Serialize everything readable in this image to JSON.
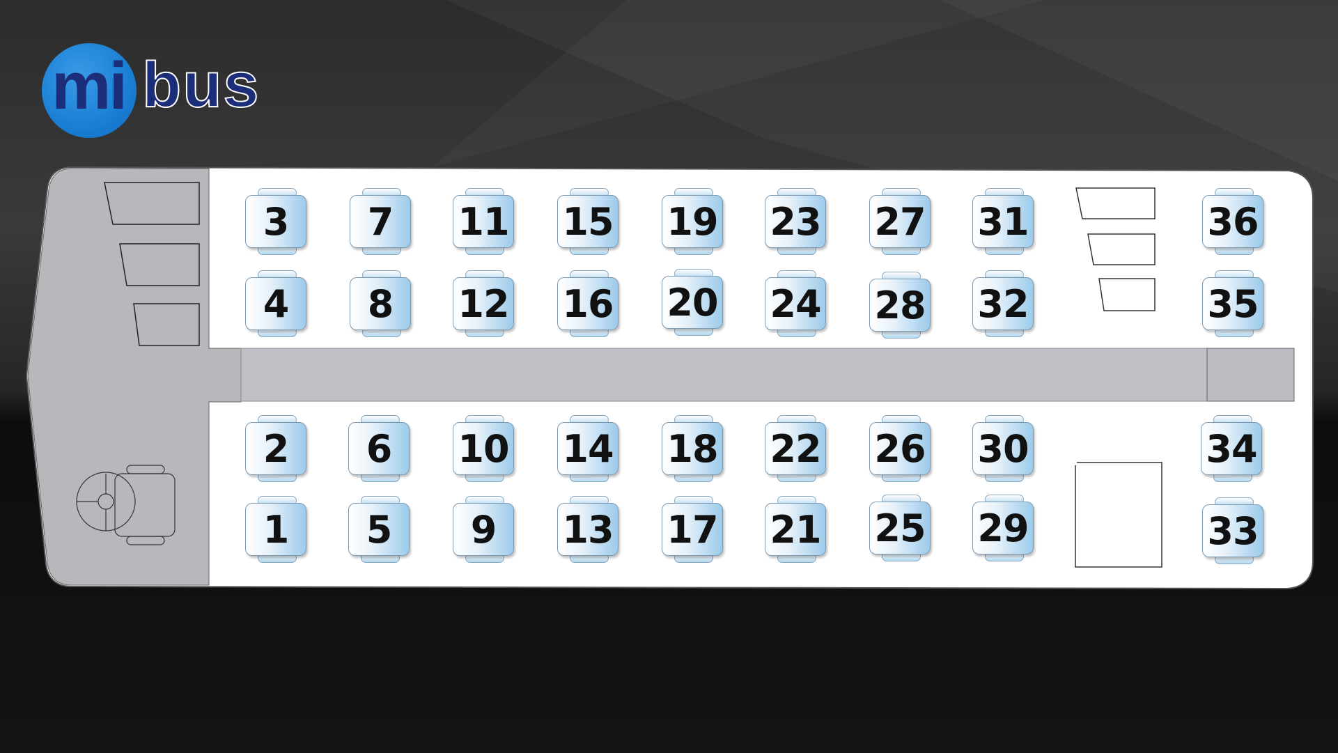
{
  "brand": {
    "prefix": "mi",
    "suffix": "bus",
    "color": "#1c2d7a",
    "circle_color": "#1a7fd4"
  },
  "colors": {
    "seat_accent": "#9ccbea",
    "aisle": "#bfbfc6",
    "driver_area": "#b8b8bc"
  },
  "seats": {
    "top_window": [
      "3",
      "7",
      "11",
      "15",
      "19",
      "23",
      "27",
      "31",
      "36"
    ],
    "top_aisle": [
      "4",
      "8",
      "12",
      "16",
      "20",
      "24",
      "28",
      "32",
      "35"
    ],
    "bottom_aisle": [
      "2",
      "6",
      "10",
      "14",
      "18",
      "22",
      "26",
      "30",
      "34"
    ],
    "bottom_window": [
      "1",
      "5",
      "9",
      "13",
      "17",
      "21",
      "25",
      "29",
      "33"
    ]
  }
}
